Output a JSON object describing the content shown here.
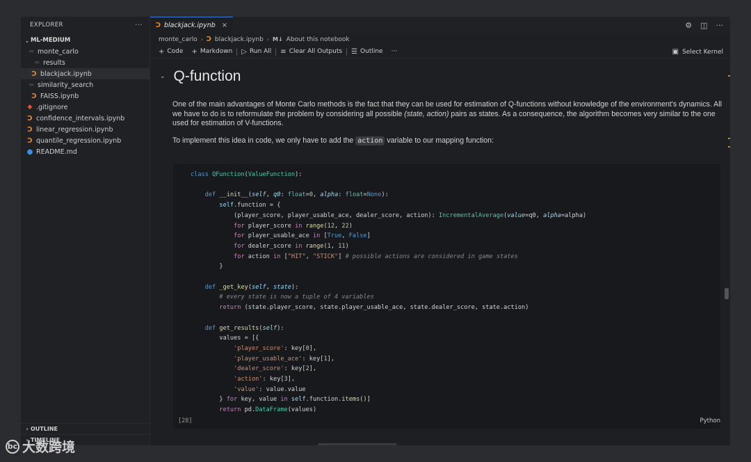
{
  "sidebar": {
    "header": "EXPLORER",
    "more": "···",
    "root": "ML-MEDIUM",
    "items": [
      {
        "label": "monte_carlo",
        "type": "folder"
      },
      {
        "label": "results",
        "type": "folder"
      },
      {
        "label": "blackjack.ipynb",
        "type": "notebook"
      },
      {
        "label": "similarity_search",
        "type": "folder"
      },
      {
        "label": "FAISS.ipynb",
        "type": "notebook"
      },
      {
        "label": ".gitignore",
        "type": "git"
      },
      {
        "label": "confidence_intervals.ipynb",
        "type": "notebook"
      },
      {
        "label": "linear_regression.ipynb",
        "type": "notebook"
      },
      {
        "label": "quantile_regression.ipynb",
        "type": "notebook"
      },
      {
        "label": "README.md",
        "type": "info"
      }
    ],
    "outline": "OUTLINE",
    "timeline": "TIMELINE"
  },
  "tab": {
    "label": "blackjack.ipynb",
    "close": "×"
  },
  "breadcrumbs": {
    "folder": "monte_carlo",
    "file": "blackjack.ipynb",
    "md_badge": "M↓",
    "section": "About this notebook"
  },
  "toolbar": {
    "code": "Code",
    "markdown": "Markdown",
    "run_all": "Run All",
    "clear_all": "Clear All Outputs",
    "outline": "Outline",
    "more": "···",
    "kernel": "Select Kernel"
  },
  "notebook": {
    "heading": "Q-function",
    "para1_a": "One of the main advantages of Monte Carlo methods is the fact that they can be used for estimation of Q-functions without knowledge of the environment's dynamics. All we have to do is to reformulate the problem by considering all possible ",
    "para1_em": "(state, action)",
    "para1_b": " pairs as states. As a consequence, the algorithm becomes very similar to the one used for estimation of V-functions.",
    "para2_a": "To implement this idea in code, we only have to add the ",
    "para2_code": "action",
    "para2_b": " variable to our mapping function:",
    "cell_count": "[28]",
    "cell_lang": "Python"
  },
  "watermark": {
    "text": "大数跨境",
    "logo": "bc"
  },
  "colors": {
    "accent": "#3d7bd9",
    "notebook_icon": "#e98a32",
    "git_icon": "#e0533a",
    "info_icon": "#3b8eea"
  }
}
